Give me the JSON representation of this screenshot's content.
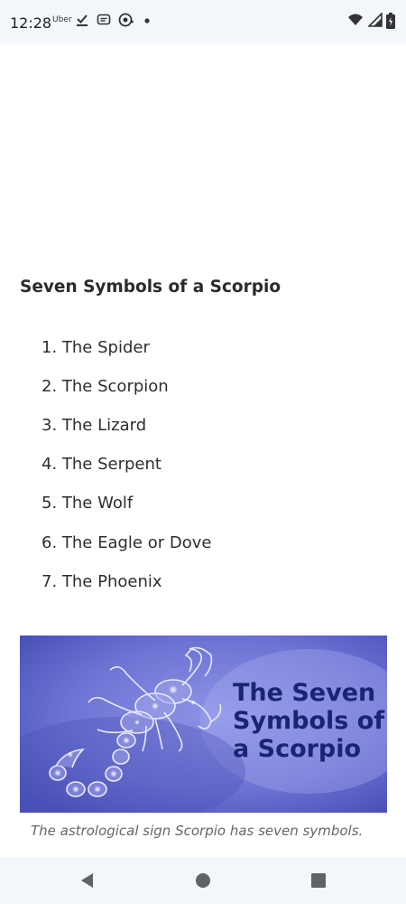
{
  "status_bar": {
    "time": "12:28",
    "notification_app": "Uber",
    "icons": [
      "uber-icon",
      "check-icon",
      "message-icon",
      "chat-bubble-icon",
      "dot-icon",
      "wifi-icon",
      "signal-icon",
      "battery-icon"
    ]
  },
  "article": {
    "heading": "Seven Symbols of a Scorpio",
    "symbols": [
      "The Spider",
      "The Scorpion",
      "The Lizard",
      "The Serpent",
      "The Wolf",
      "The Eagle or Dove",
      "The Phoenix"
    ],
    "image": {
      "title_lines": [
        "The Seven",
        "Symbols of",
        "a Scorpio"
      ],
      "background_color": "#5a5fc7",
      "text_color": "#1a2473"
    },
    "caption": "The astrological sign Scorpio has seven symbols."
  },
  "nav_bar": {
    "buttons": [
      "back-icon",
      "home-icon",
      "recents-icon"
    ]
  }
}
